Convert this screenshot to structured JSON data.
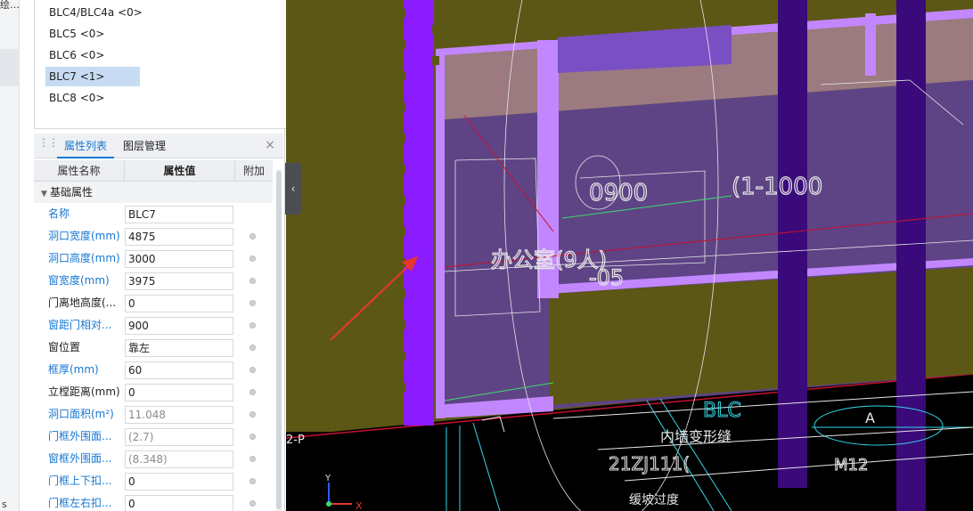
{
  "left_strip": {
    "top_text": "绘…",
    "bottom_text": "s"
  },
  "floor_list": {
    "items": [
      {
        "label": "BLC4/BLC4a <0>",
        "selected": false
      },
      {
        "label": "BLC5 <0>",
        "selected": false
      },
      {
        "label": "BLC6 <0>",
        "selected": false
      },
      {
        "label": "BLC7 <1>",
        "selected": true
      },
      {
        "label": "BLC8 <0>",
        "selected": false
      }
    ]
  },
  "tabs": {
    "active": "属性列表",
    "inactive": "图层管理",
    "close": "×"
  },
  "grid": {
    "headers": {
      "name": "属性名称",
      "value": "属性值",
      "extra": "附加"
    },
    "group": {
      "label": "基础属性",
      "caret": "▼"
    },
    "rows": [
      {
        "name": "名称",
        "value": "BLC7",
        "blue": true,
        "readonly": false,
        "dot": false
      },
      {
        "name": "洞口宽度(mm)",
        "value": "4875",
        "blue": true,
        "readonly": false,
        "dot": true
      },
      {
        "name": "洞口高度(mm)",
        "value": "3000",
        "blue": true,
        "readonly": false,
        "dot": true
      },
      {
        "name": "窗宽度(mm)",
        "value": "3975",
        "blue": true,
        "readonly": false,
        "dot": true
      },
      {
        "name": "门离地高度(...",
        "value": "0",
        "blue": false,
        "readonly": false,
        "dot": true
      },
      {
        "name": "窗距门相对...",
        "value": "900",
        "blue": true,
        "readonly": false,
        "dot": true
      },
      {
        "name": "窗位置",
        "value": "靠左",
        "blue": false,
        "readonly": false,
        "dot": true
      },
      {
        "name": "框厚(mm)",
        "value": "60",
        "blue": true,
        "readonly": false,
        "dot": true
      },
      {
        "name": "立樘距离(mm)",
        "value": "0",
        "blue": false,
        "readonly": false,
        "dot": true
      },
      {
        "name": "洞口面积(m²)",
        "value": "11.048",
        "blue": true,
        "readonly": true,
        "dot": true
      },
      {
        "name": "门框外围面...",
        "value": "(2.7)",
        "blue": true,
        "readonly": true,
        "dot": true
      },
      {
        "name": "窗框外围面...",
        "value": "(8.348)",
        "blue": true,
        "readonly": true,
        "dot": true
      },
      {
        "name": "门框上下扣...",
        "value": "0",
        "blue": true,
        "readonly": false,
        "dot": true
      },
      {
        "name": "门框左右扣...",
        "value": "0",
        "blue": true,
        "readonly": false,
        "dot": true
      }
    ]
  },
  "collapse_tab": {
    "icon": "‹"
  },
  "viewport": {
    "cad_texts": {
      "t1": "BLC",
      "t2": "内墙变形缝",
      "t3": "21ZJ111(",
      "t4": "缓坡过度",
      "t5": "A",
      "t6": "M12",
      "t7": "2-P",
      "t8": "0900",
      "t9": "(1-1000",
      "t10": "办公室(9人)",
      "t11": "-05"
    },
    "axis": {
      "x": "X",
      "y": "Y"
    },
    "colors": {
      "wall_olive": "#5c5715",
      "purple_frame": "#c287ff",
      "glass": "#5e4485",
      "violet_column": "#3a0a7a",
      "arrow": "#e8372c"
    }
  }
}
